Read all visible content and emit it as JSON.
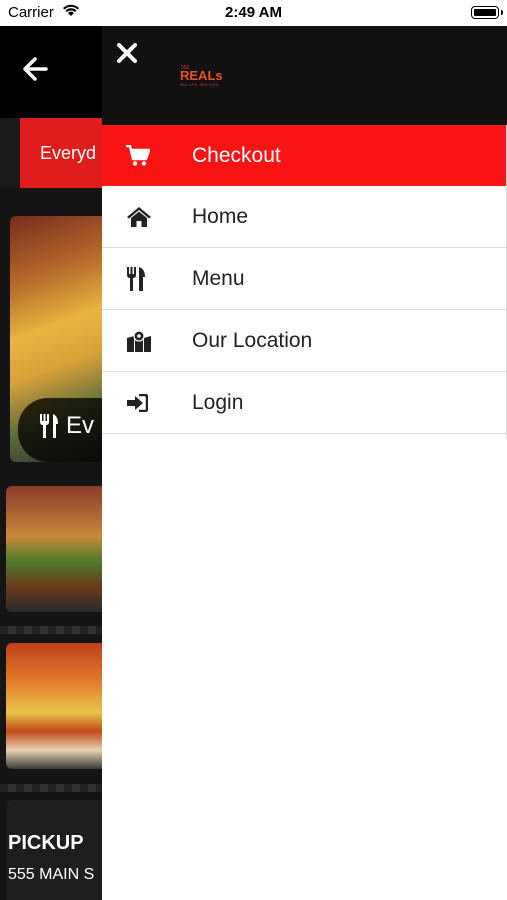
{
  "status_bar": {
    "carrier": "Carrier",
    "time": "2:49 AM"
  },
  "background": {
    "tab_label": "Everyd",
    "card_label": "Ev",
    "pickup_title": "PICKUP",
    "pickup_address": "555 MAIN S"
  },
  "drawer": {
    "logo_text": "REALs",
    "logo_small": "555",
    "logo_tagline": "REAL EATS · REAL GOOD",
    "items": [
      {
        "label": "Checkout",
        "icon": "cart-icon",
        "active": true
      },
      {
        "label": "Home",
        "icon": "home-icon",
        "active": false
      },
      {
        "label": "Menu",
        "icon": "utensils-icon",
        "active": false
      },
      {
        "label": "Our Location",
        "icon": "map-marker-icon",
        "active": false
      },
      {
        "label": "Login",
        "icon": "sign-in-icon",
        "active": false
      }
    ]
  },
  "colors": {
    "accent": "#fb1414",
    "header": "#111111"
  }
}
